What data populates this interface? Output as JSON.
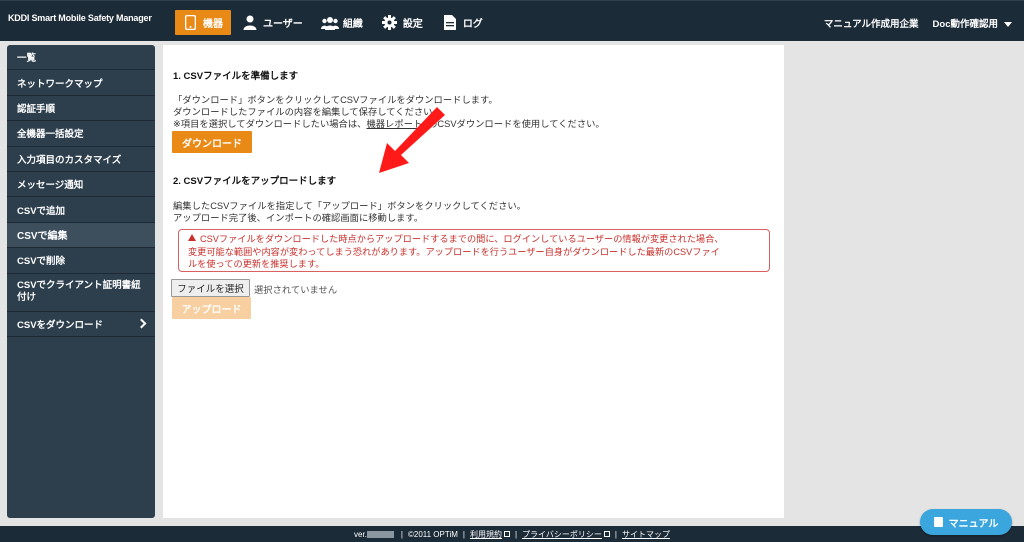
{
  "header": {
    "brand": "KDDI Smart Mobile Safety Manager",
    "nav": [
      {
        "label": "機器",
        "icon": "phone-icon",
        "active": true
      },
      {
        "label": "ユーザー",
        "icon": "user-icon"
      },
      {
        "label": "組織",
        "icon": "group-icon"
      },
      {
        "label": "設定",
        "icon": "gear-icon"
      },
      {
        "label": "ログ",
        "icon": "document-icon"
      }
    ],
    "company": "マニュアル作成用企業",
    "user": "Doc動作確認用"
  },
  "sidebar": {
    "items": [
      {
        "label": "一覧"
      },
      {
        "label": "ネットワークマップ"
      },
      {
        "label": "認証手順"
      },
      {
        "label": "全機器一括設定"
      },
      {
        "label": "入力項目のカスタマイズ"
      },
      {
        "label": "メッセージ通知"
      },
      {
        "label": "CSVで追加"
      },
      {
        "label": "CSVで編集",
        "active": true
      },
      {
        "label": "CSVで削除"
      },
      {
        "label": "CSVでクライアント証明書紐付け"
      },
      {
        "label": "CSVをダウンロード"
      }
    ]
  },
  "main": {
    "section1": {
      "title": "1. CSVファイルを準備します",
      "line1": "「ダウンロード」ボタンをクリックしてCSVファイルをダウンロードします。",
      "line2": "ダウンロードしたファイルの内容を編集して保存してください。",
      "line3_pre": "※項目を選択してダウンロードしたい場合は、",
      "line3_link": "機器レポート",
      "line3_post": "のCSVダウンロードを使用してください。",
      "download_label": "ダウンロード"
    },
    "section2": {
      "title": "2. CSVファイルをアップロードします",
      "line1": "編集したCSVファイルを指定して「アップロード」ボタンをクリックしてください。",
      "line2": "アップロード完了後、インポートの確認画面に移動します。",
      "warning_line1": "CSVファイルをダウンロードした時点からアップロードするまでの間に、ログインしているユーザーの情報が変更された場合、",
      "warning_line2": "変更可能な範囲や内容が変わってしまう恐れがあります。アップロードを行うユーザー自身がダウンロードした最新のCSVファイ",
      "warning_line3": "ルを使っての更新を推奨します。",
      "file_button_label": "ファイルを選択",
      "file_status": "選択されていません",
      "upload_label": "アップロード"
    }
  },
  "footer": {
    "ver_prefix": "ver.",
    "copyright": "©2011 OPTiM",
    "terms": "利用規約",
    "privacy": "プライバシーポリシー",
    "sitemap": "サイトマップ"
  },
  "manual_button": "マニュアル",
  "colors": {
    "accent": "#ea8a16",
    "header": "#1c2b38",
    "sidebar": "#2d3f4d",
    "warning": "#c9302c",
    "help": "#3aa6dd"
  }
}
